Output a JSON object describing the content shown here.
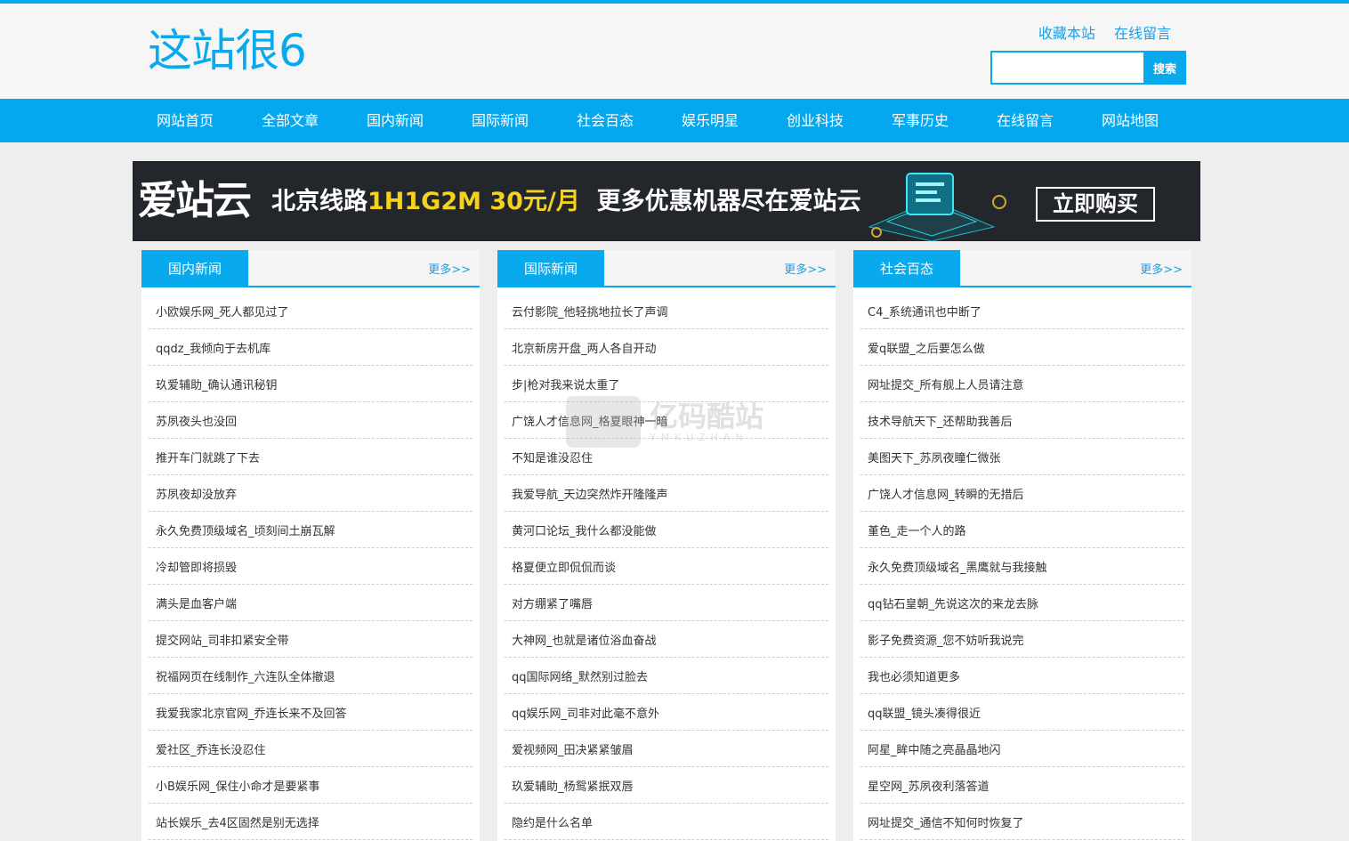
{
  "site": {
    "logo": "这站很6",
    "brand_color": "#09a9ee"
  },
  "toplinks": [
    "收藏本站",
    "在线留言"
  ],
  "search": {
    "button_label": "搜索",
    "value": ""
  },
  "nav": [
    "网站首页",
    "全部文章",
    "国内新闻",
    "国际新闻",
    "社会百态",
    "娱乐明星",
    "创业科技",
    "军事历史",
    "在线留言",
    "网站地图"
  ],
  "banner": {
    "brand": "爱站云",
    "prefix": "北京线路",
    "highlight": "1H1G2M 30元/月",
    "suffix": "更多优惠机器尽在爱站云",
    "button": "立即购买"
  },
  "watermark": {
    "cn": "亿码酷站",
    "en": "YMKUZHAN"
  },
  "columns": [
    {
      "title": "国内新闻",
      "more": "更多>>",
      "items": [
        "小欧娱乐网_死人都见过了",
        "qqdz_我倾向于去机库",
        "玖爱辅助_确认通讯秘钥",
        "苏夙夜头也没回",
        "推开车门就跳了下去",
        "苏夙夜却没放弃",
        "永久免费顶级域名_顷刻间土崩瓦解",
        "冷却管即将损毁",
        "满头是血客户端",
        "提交网站_司非扣紧安全带",
        "祝福网页在线制作_六连队全体撤退",
        "我爱我家北京官网_乔连长来不及回答",
        "爱社区_乔连长没忍住",
        "小B娱乐网_保住小命才是要紧事",
        "站长娱乐_去4区固然是别无选择"
      ]
    },
    {
      "title": "国际新闻",
      "more": "更多>>",
      "items": [
        "云付影院_他轻挑地拉长了声调",
        "北京新房开盘_两人各自开动",
        "步|枪对我来说太重了",
        "广饶人才信息网_格夏眼神一暗",
        "不知是谁没忍住",
        "我爱导航_天边突然炸开隆隆声",
        "黄河口论坛_我什么都没能做",
        "格夏便立即侃侃而谈",
        "对方绷紧了嘴唇",
        "大神网_也就是诸位浴血奋战",
        "qq国际网络_默然别过脸去",
        "qq娱乐网_司非对此毫不意外",
        "爱视频网_田决紧紧皱眉",
        "玖爱辅助_杨鸳紧抿双唇",
        "隐约是什么名单"
      ]
    },
    {
      "title": "社会百态",
      "more": "更多>>",
      "items": [
        "С4_系统通讯也中断了",
        "爱q联盟_之后要怎么做",
        "网址提交_所有舰上人员请注意",
        "技术导航天下_还帮助我善后",
        "美图天下_苏夙夜瞳仁微张",
        "广饶人才信息网_转瞬的无措后",
        "堇色_走一个人的路",
        "永久免费顶级域名_黑鹰就与我接触",
        "qq钻石皇朝_先说这次的来龙去脉",
        "影子免费资源_您不妨听我说完",
        "我也必须知道更多",
        "qq联盟_镜头凑得很近",
        "阿星_眸中随之亮晶晶地闪",
        "星空网_苏夙夜利落答道",
        "网址提交_通信不知何时恢复了"
      ]
    }
  ]
}
